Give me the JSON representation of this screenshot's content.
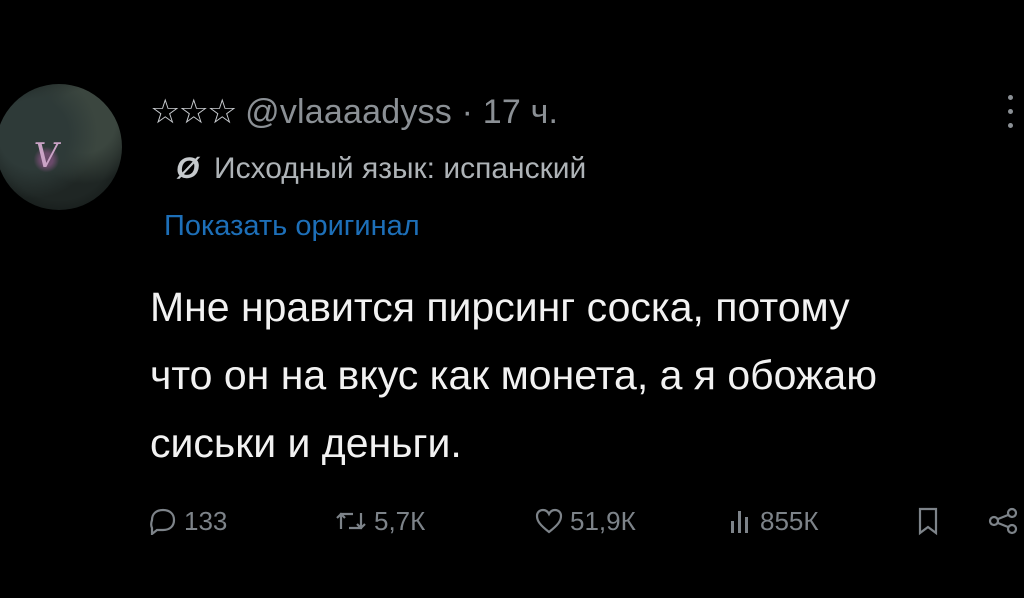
{
  "tweet": {
    "stars": "☆☆☆",
    "handle": "@vlaaaadyss",
    "separator": "·",
    "time": "17 ч.",
    "language_note": "Исходный язык: испанский",
    "language_icon": "Ø",
    "show_original": "Показать оригинал",
    "text_lines": [
      "Мне нравится пирсинг соска, потому",
      "что он на вкус как монета, а я обожаю",
      "сиськи и деньги."
    ]
  },
  "avatar": {
    "letter": "Ⅴ"
  },
  "stats": {
    "replies": "133",
    "retweets": "5,7К",
    "likes": "51,9К",
    "views": "855К"
  },
  "icons": {
    "reply": "reply-icon",
    "retweet": "retweet-icon",
    "like": "heart-icon",
    "views": "views-icon",
    "bookmark": "bookmark-icon",
    "share": "share-icon",
    "more": "more-icon"
  },
  "colors": {
    "background": "#000000",
    "text": "#f2f2f2",
    "muted": "#8b9095",
    "link": "#1d6fb8"
  }
}
